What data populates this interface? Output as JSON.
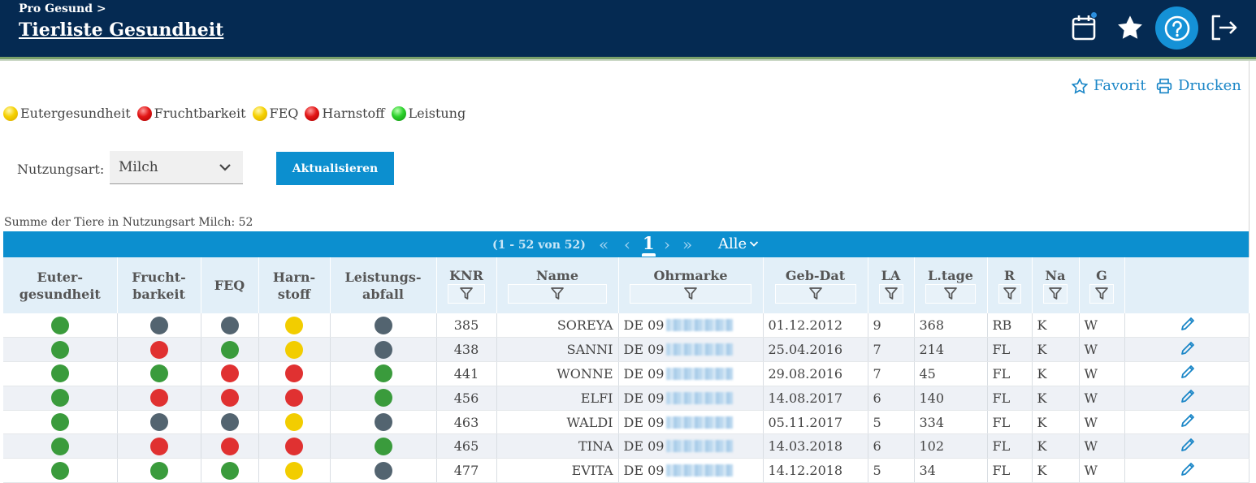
{
  "header": {
    "breadcrumb": "Pro Gesund >",
    "title": "Tierliste Gesundheit",
    "icons": [
      "calendar-icon",
      "star-icon",
      "help-icon",
      "logout-icon"
    ]
  },
  "actions": {
    "favorit": "Favorit",
    "drucken": "Drucken"
  },
  "legend": [
    {
      "label": "Eutergesundheit",
      "color": "#f5d000"
    },
    {
      "label": "Fruchtbarkeit",
      "color": "#e21616"
    },
    {
      "label": "FEQ",
      "color": "#f5d000"
    },
    {
      "label": "Harnstoff",
      "color": "#e21616"
    },
    {
      "label": "Leistung",
      "color": "#2bd12b"
    }
  ],
  "filter": {
    "label": "Nutzungsart:",
    "selected": "Milch",
    "button": "Aktualisieren"
  },
  "summe": "Summe der Tiere in Nutzungsart Milch: 52",
  "pager": {
    "range": "(1 - 52 von 52)",
    "current": "1",
    "page_size": "Alle"
  },
  "columns": {
    "euter": "Euter-\ngesundheit",
    "frucht": "Frucht-\nbarkeit",
    "feq": "FEQ",
    "harn": "Harn-\nstoff",
    "leist": "Leistungs-\nabfall",
    "knr": "KNR",
    "name": "Name",
    "ohrmarke": "Ohrmarke",
    "gebdat": "Geb-Dat",
    "la": "LA",
    "ltage": "L.tage",
    "r": "R",
    "na": "Na",
    "g": "G"
  },
  "colors": {
    "green": "#3a9b3c",
    "grey": "#536470",
    "red": "#e03131",
    "yellow": "#f2cd00",
    "header": "#052a52",
    "accent": "#0c8fcf"
  },
  "rows": [
    {
      "euter": "green",
      "frucht": "grey",
      "feq": "grey",
      "harn": "yellow",
      "leist": "grey",
      "knr": "385",
      "name": "SOREYA",
      "ohr": "DE 09",
      "geb": "01.12.2012",
      "la": "9",
      "ltage": "368",
      "r": "RB",
      "na": "K",
      "g": "W"
    },
    {
      "euter": "green",
      "frucht": "red",
      "feq": "green",
      "harn": "yellow",
      "leist": "grey",
      "knr": "438",
      "name": "SANNI",
      "ohr": "DE 09",
      "geb": "25.04.2016",
      "la": "7",
      "ltage": "214",
      "r": "FL",
      "na": "K",
      "g": "W"
    },
    {
      "euter": "green",
      "frucht": "green",
      "feq": "red",
      "harn": "red",
      "leist": "green",
      "knr": "441",
      "name": "WONNE",
      "ohr": "DE 09",
      "geb": "29.08.2016",
      "la": "7",
      "ltage": "45",
      "r": "FL",
      "na": "K",
      "g": "W"
    },
    {
      "euter": "green",
      "frucht": "red",
      "feq": "red",
      "harn": "red",
      "leist": "green",
      "knr": "456",
      "name": "ELFI",
      "ohr": "DE 09",
      "geb": "14.08.2017",
      "la": "6",
      "ltage": "140",
      "r": "FL",
      "na": "K",
      "g": "W"
    },
    {
      "euter": "green",
      "frucht": "grey",
      "feq": "grey",
      "harn": "yellow",
      "leist": "grey",
      "knr": "463",
      "name": "WALDI",
      "ohr": "DE 09",
      "geb": "05.11.2017",
      "la": "5",
      "ltage": "334",
      "r": "FL",
      "na": "K",
      "g": "W"
    },
    {
      "euter": "green",
      "frucht": "red",
      "feq": "red",
      "harn": "red",
      "leist": "green",
      "knr": "465",
      "name": "TINA",
      "ohr": "DE 09",
      "geb": "14.03.2018",
      "la": "6",
      "ltage": "102",
      "r": "FL",
      "na": "K",
      "g": "W"
    },
    {
      "euter": "green",
      "frucht": "green",
      "feq": "green",
      "harn": "yellow",
      "leist": "grey",
      "knr": "477",
      "name": "EVITA",
      "ohr": "DE 09",
      "geb": "14.12.2018",
      "la": "5",
      "ltage": "34",
      "r": "FL",
      "na": "K",
      "g": "W"
    }
  ]
}
